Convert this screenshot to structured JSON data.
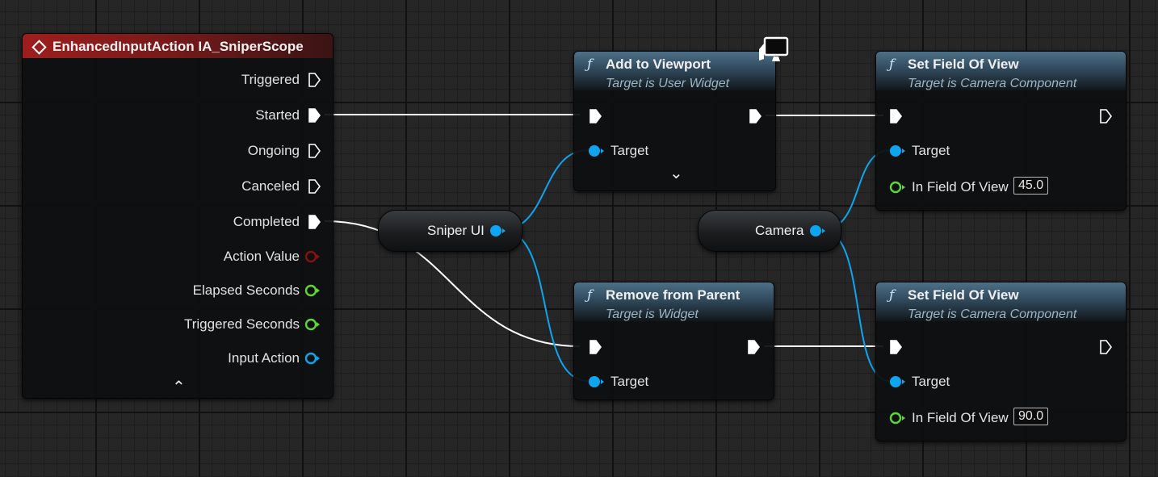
{
  "event_node": {
    "title": "EnhancedInputAction IA_SniperScope",
    "pins": {
      "triggered": "Triggered",
      "started": "Started",
      "ongoing": "Ongoing",
      "canceled": "Canceled",
      "completed": "Completed",
      "action_value": "Action Value",
      "elapsed_seconds": "Elapsed Seconds",
      "triggered_seconds": "Triggered Seconds",
      "input_action": "Input Action"
    }
  },
  "add_to_viewport": {
    "title": "Add to Viewport",
    "subtitle": "Target is User Widget",
    "target_label": "Target"
  },
  "remove_from_parent": {
    "title": "Remove from Parent",
    "subtitle": "Target is Widget",
    "target_label": "Target"
  },
  "set_fov_top": {
    "title": "Set Field Of View",
    "subtitle": "Target is Camera Component",
    "target_label": "Target",
    "fov_label": "In Field Of View",
    "fov_value": "45.0"
  },
  "set_fov_bottom": {
    "title": "Set Field Of View",
    "subtitle": "Target is Camera Component",
    "target_label": "Target",
    "fov_label": "In Field Of View",
    "fov_value": "90.0"
  },
  "variables": {
    "sniper_ui": "Sniper UI",
    "camera": "Camera"
  },
  "glyphs": {
    "function": "ƒ",
    "expand": "⌄",
    "collapse": "⌃"
  },
  "colors": {
    "exec_wire": "#ffffff",
    "object_pin": "#0ea5f0",
    "float_pin": "#5ed633",
    "struct_pin": "#8a1010",
    "function_header": "#4d7088",
    "event_header": "#9e1e1e"
  },
  "icons": {
    "function": "function-icon",
    "event": "event-diamond-icon",
    "exec": "exec-pin-icon",
    "monitor": "widget-monitor-icon"
  }
}
